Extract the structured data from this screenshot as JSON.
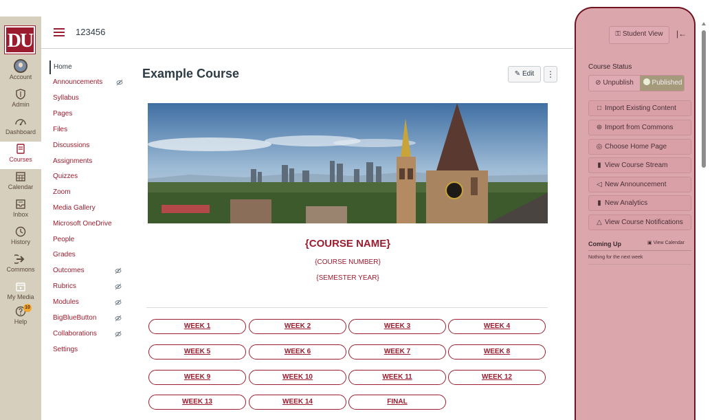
{
  "global_nav": {
    "logo": "DU",
    "items": [
      {
        "label": "Account",
        "icon": "avatar"
      },
      {
        "label": "Admin",
        "icon": "shield-icon"
      },
      {
        "label": "Dashboard",
        "icon": "dashboard-icon"
      },
      {
        "label": "Courses",
        "icon": "book-icon"
      },
      {
        "label": "Calendar",
        "icon": "calendar-icon"
      },
      {
        "label": "Inbox",
        "icon": "inbox-icon"
      },
      {
        "label": "History",
        "icon": "clock-icon"
      },
      {
        "label": "Commons",
        "icon": "commons-icon"
      },
      {
        "label": "My Media",
        "icon": "media-icon"
      },
      {
        "label": "Help",
        "icon": "help-icon",
        "badge": "10"
      }
    ]
  },
  "header": {
    "breadcrumb": "123456"
  },
  "course_nav": {
    "items": [
      {
        "label": "Home"
      },
      {
        "label": "Announcements"
      },
      {
        "label": "Syllabus"
      },
      {
        "label": "Pages"
      },
      {
        "label": "Files"
      },
      {
        "label": "Discussions"
      },
      {
        "label": "Assignments"
      },
      {
        "label": "Quizzes"
      },
      {
        "label": "Zoom"
      },
      {
        "label": "Media Gallery"
      },
      {
        "label": "Microsoft OneDrive"
      },
      {
        "label": "People"
      },
      {
        "label": "Grades"
      },
      {
        "label": "Outcomes"
      },
      {
        "label": "Rubrics"
      },
      {
        "label": "Modules"
      },
      {
        "label": "BigBlueButton"
      },
      {
        "label": "Collaborations"
      },
      {
        "label": "Settings"
      }
    ]
  },
  "main": {
    "title": "Example Course",
    "edit_label": "Edit",
    "kebab": "⋮",
    "course_name": "{COURSE NAME}",
    "course_number": "{COURSE NUMBER}",
    "semester_year": "{SEMESTER YEAR}",
    "weeks": [
      "WEEK 1",
      "WEEK 2",
      "WEEK 3",
      "WEEK 4",
      "WEEK 5",
      "WEEK 6",
      "WEEK 7",
      "WEEK 8",
      "WEEK 9",
      "WEEK 10",
      "WEEK 11",
      "WEEK 12",
      "WEEK 13",
      "WEEK 14",
      "FINAL"
    ]
  },
  "right_panel": {
    "student_view": "Student View",
    "course_status_heading": "Course Status",
    "unpublish": "Unpublish",
    "published": "Published",
    "actions": [
      {
        "label": "Import Existing Content",
        "icon": "import-icon"
      },
      {
        "label": "Import from Commons",
        "icon": "commons-icon"
      },
      {
        "label": "Choose Home Page",
        "icon": "home-page-icon"
      },
      {
        "label": "View Course Stream",
        "icon": "stream-icon"
      },
      {
        "label": "New Announcement",
        "icon": "announcement-icon"
      },
      {
        "label": "New Analytics",
        "icon": "analytics-icon"
      },
      {
        "label": "View Course Notifications",
        "icon": "bell-icon"
      }
    ],
    "coming_up": "Coming Up",
    "view_calendar": "View Calendar",
    "nothing": "Nothing for the next week"
  },
  "colors": {
    "brand": "#9b1c2e",
    "panel_highlight": "#dca6ad",
    "nav_bg": "#d6cfbe"
  }
}
